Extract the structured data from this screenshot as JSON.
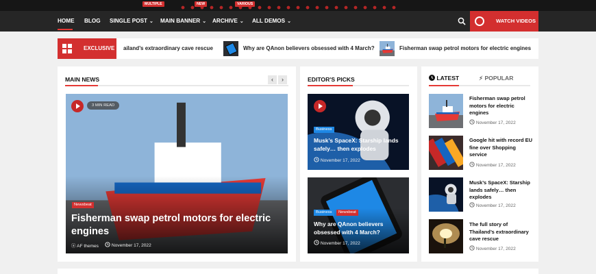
{
  "nav": {
    "items": [
      {
        "label": "HOME"
      },
      {
        "label": "BLOG"
      },
      {
        "label": "SINGLE POST",
        "badge": "MULTIPLE"
      },
      {
        "label": "MAIN BANNER",
        "badge": "NEW"
      },
      {
        "label": "ARCHIVE",
        "badge": "VARIOUS"
      },
      {
        "label": "ALL DEMOS"
      }
    ],
    "watch_label": "WATCH VIDEOS",
    "accent_color": "#d32f2f"
  },
  "ticker": {
    "label": "EXCLUSIVE",
    "items": [
      "ailand’s extraordinary cave rescue",
      "Why are QAnon believers obsessed with 4 March?",
      "Fisherman swap petrol motors for electric engines"
    ]
  },
  "main_news": {
    "title": "MAIN NEWS",
    "prev": "‹",
    "next": "›",
    "read_badge": "3 MIN READ",
    "category": "Newsbeat",
    "headline": "Fisherman swap petrol motors for electric engines",
    "author": "AF themes",
    "date": "November 17, 2022"
  },
  "editors_picks": {
    "title": "EDITOR'S PICKS",
    "cards": [
      {
        "categories": [
          "Business"
        ],
        "headline": "Musk’s SpaceX: Starship lands safely… then explodes",
        "date": "November 17, 2022"
      },
      {
        "categories": [
          "Business",
          "Newsbeat"
        ],
        "headline": "Why are QAnon believers obsessed with 4 March?",
        "date": "November 17, 2022"
      }
    ]
  },
  "sidebar": {
    "tabs": [
      {
        "label": "LATEST"
      },
      {
        "label": "POPULAR"
      }
    ],
    "items": [
      {
        "title": "Fisherman swap petrol motors for electric engines",
        "date": "November 17, 2022"
      },
      {
        "title": "Google hit with record EU fine over Shopping service",
        "date": "November 17, 2022"
      },
      {
        "title": "Musk’s SpaceX: Starship lands safely… then explodes",
        "date": "November 17, 2022"
      },
      {
        "title": "The full story of Thailand’s extraordinary cave rescue",
        "date": "November 17, 2022"
      }
    ]
  }
}
